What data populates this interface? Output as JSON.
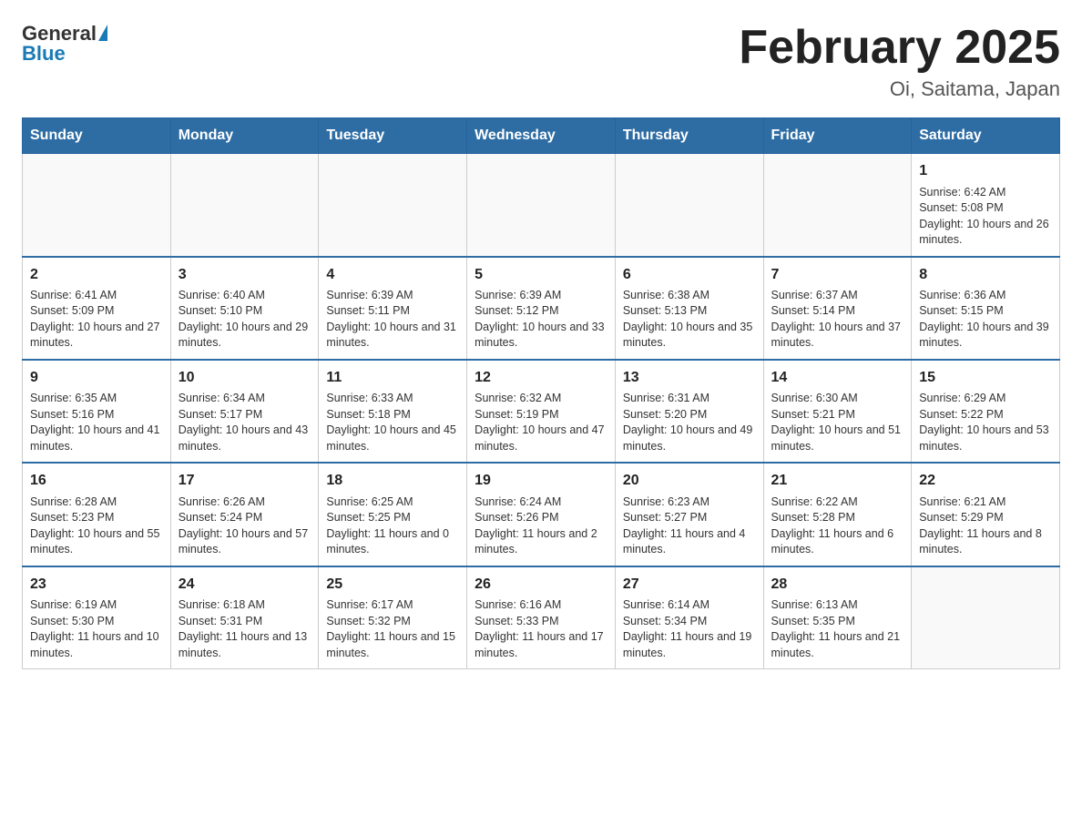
{
  "logo": {
    "general": "General",
    "triangle": "▲",
    "blue": "Blue"
  },
  "title": "February 2025",
  "subtitle": "Oi, Saitama, Japan",
  "weekdays": [
    "Sunday",
    "Monday",
    "Tuesday",
    "Wednesday",
    "Thursday",
    "Friday",
    "Saturday"
  ],
  "weeks": [
    [
      {
        "day": "",
        "info": ""
      },
      {
        "day": "",
        "info": ""
      },
      {
        "day": "",
        "info": ""
      },
      {
        "day": "",
        "info": ""
      },
      {
        "day": "",
        "info": ""
      },
      {
        "day": "",
        "info": ""
      },
      {
        "day": "1",
        "info": "Sunrise: 6:42 AM\nSunset: 5:08 PM\nDaylight: 10 hours and 26 minutes."
      }
    ],
    [
      {
        "day": "2",
        "info": "Sunrise: 6:41 AM\nSunset: 5:09 PM\nDaylight: 10 hours and 27 minutes."
      },
      {
        "day": "3",
        "info": "Sunrise: 6:40 AM\nSunset: 5:10 PM\nDaylight: 10 hours and 29 minutes."
      },
      {
        "day": "4",
        "info": "Sunrise: 6:39 AM\nSunset: 5:11 PM\nDaylight: 10 hours and 31 minutes."
      },
      {
        "day": "5",
        "info": "Sunrise: 6:39 AM\nSunset: 5:12 PM\nDaylight: 10 hours and 33 minutes."
      },
      {
        "day": "6",
        "info": "Sunrise: 6:38 AM\nSunset: 5:13 PM\nDaylight: 10 hours and 35 minutes."
      },
      {
        "day": "7",
        "info": "Sunrise: 6:37 AM\nSunset: 5:14 PM\nDaylight: 10 hours and 37 minutes."
      },
      {
        "day": "8",
        "info": "Sunrise: 6:36 AM\nSunset: 5:15 PM\nDaylight: 10 hours and 39 minutes."
      }
    ],
    [
      {
        "day": "9",
        "info": "Sunrise: 6:35 AM\nSunset: 5:16 PM\nDaylight: 10 hours and 41 minutes."
      },
      {
        "day": "10",
        "info": "Sunrise: 6:34 AM\nSunset: 5:17 PM\nDaylight: 10 hours and 43 minutes."
      },
      {
        "day": "11",
        "info": "Sunrise: 6:33 AM\nSunset: 5:18 PM\nDaylight: 10 hours and 45 minutes."
      },
      {
        "day": "12",
        "info": "Sunrise: 6:32 AM\nSunset: 5:19 PM\nDaylight: 10 hours and 47 minutes."
      },
      {
        "day": "13",
        "info": "Sunrise: 6:31 AM\nSunset: 5:20 PM\nDaylight: 10 hours and 49 minutes."
      },
      {
        "day": "14",
        "info": "Sunrise: 6:30 AM\nSunset: 5:21 PM\nDaylight: 10 hours and 51 minutes."
      },
      {
        "day": "15",
        "info": "Sunrise: 6:29 AM\nSunset: 5:22 PM\nDaylight: 10 hours and 53 minutes."
      }
    ],
    [
      {
        "day": "16",
        "info": "Sunrise: 6:28 AM\nSunset: 5:23 PM\nDaylight: 10 hours and 55 minutes."
      },
      {
        "day": "17",
        "info": "Sunrise: 6:26 AM\nSunset: 5:24 PM\nDaylight: 10 hours and 57 minutes."
      },
      {
        "day": "18",
        "info": "Sunrise: 6:25 AM\nSunset: 5:25 PM\nDaylight: 11 hours and 0 minutes."
      },
      {
        "day": "19",
        "info": "Sunrise: 6:24 AM\nSunset: 5:26 PM\nDaylight: 11 hours and 2 minutes."
      },
      {
        "day": "20",
        "info": "Sunrise: 6:23 AM\nSunset: 5:27 PM\nDaylight: 11 hours and 4 minutes."
      },
      {
        "day": "21",
        "info": "Sunrise: 6:22 AM\nSunset: 5:28 PM\nDaylight: 11 hours and 6 minutes."
      },
      {
        "day": "22",
        "info": "Sunrise: 6:21 AM\nSunset: 5:29 PM\nDaylight: 11 hours and 8 minutes."
      }
    ],
    [
      {
        "day": "23",
        "info": "Sunrise: 6:19 AM\nSunset: 5:30 PM\nDaylight: 11 hours and 10 minutes."
      },
      {
        "day": "24",
        "info": "Sunrise: 6:18 AM\nSunset: 5:31 PM\nDaylight: 11 hours and 13 minutes."
      },
      {
        "day": "25",
        "info": "Sunrise: 6:17 AM\nSunset: 5:32 PM\nDaylight: 11 hours and 15 minutes."
      },
      {
        "day": "26",
        "info": "Sunrise: 6:16 AM\nSunset: 5:33 PM\nDaylight: 11 hours and 17 minutes."
      },
      {
        "day": "27",
        "info": "Sunrise: 6:14 AM\nSunset: 5:34 PM\nDaylight: 11 hours and 19 minutes."
      },
      {
        "day": "28",
        "info": "Sunrise: 6:13 AM\nSunset: 5:35 PM\nDaylight: 11 hours and 21 minutes."
      },
      {
        "day": "",
        "info": ""
      }
    ]
  ]
}
